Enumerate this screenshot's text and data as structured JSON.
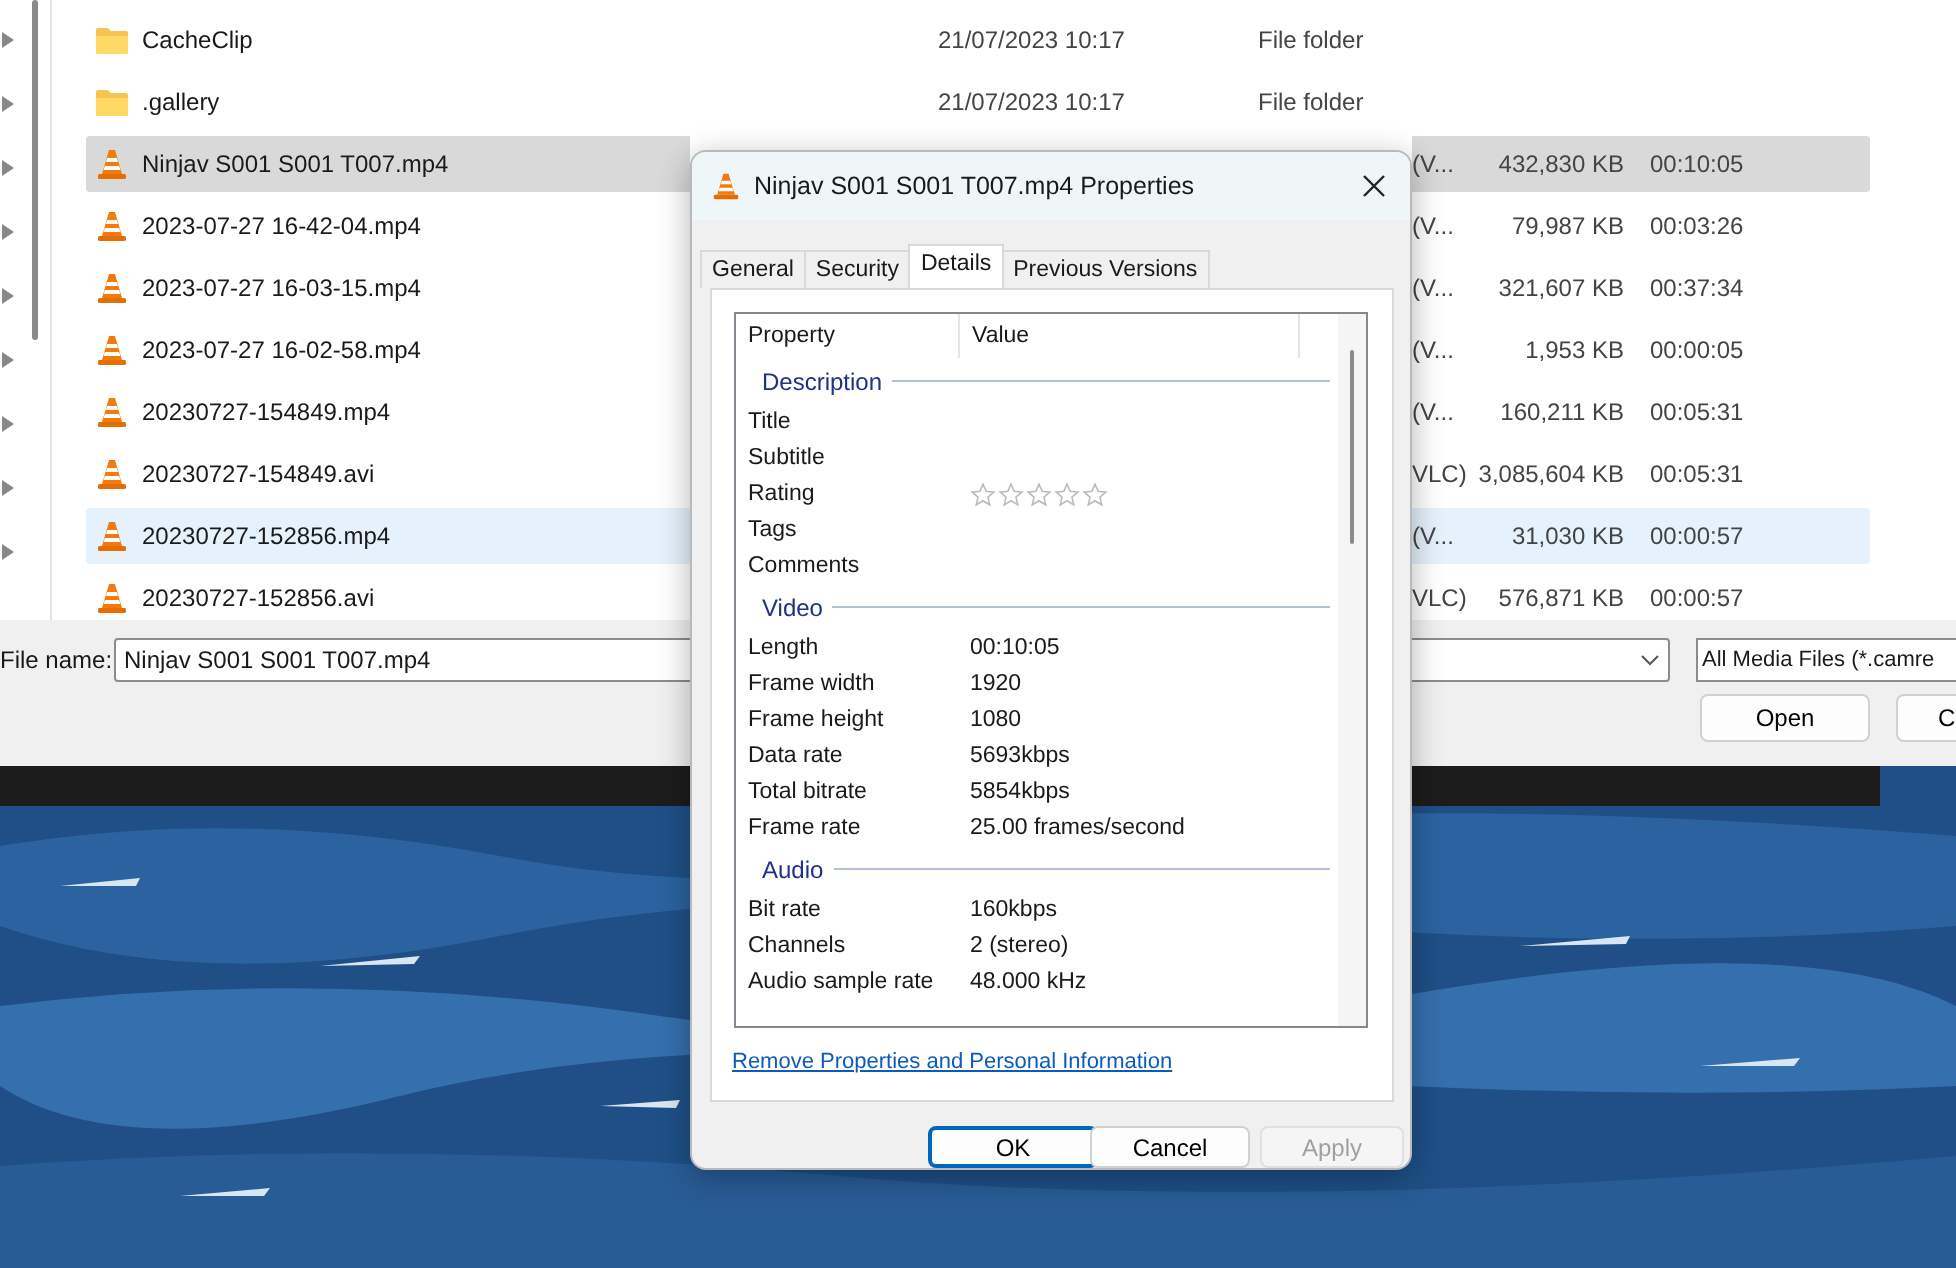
{
  "file_dialog": {
    "files": [
      {
        "kind": "folder",
        "name": "CacheClip",
        "date": "21/07/2023 10:17",
        "type": "File folder",
        "selected": false,
        "hovered": false
      },
      {
        "kind": "folder",
        "name": ".gallery",
        "date": "21/07/2023 10:17",
        "type": "File folder",
        "selected": false,
        "hovered": false
      },
      {
        "kind": "video",
        "name": "Ninjav S001 S001 T007.mp4",
        "type": "(V...",
        "size": "432,830 KB",
        "length": "00:10:05",
        "selected": true,
        "hovered": false
      },
      {
        "kind": "video",
        "name": "2023-07-27 16-42-04.mp4",
        "type": "(V...",
        "size": "79,987 KB",
        "length": "00:03:26",
        "selected": false,
        "hovered": false
      },
      {
        "kind": "video",
        "name": "2023-07-27 16-03-15.mp4",
        "type": "(V...",
        "size": "321,607 KB",
        "length": "00:37:34",
        "selected": false,
        "hovered": false
      },
      {
        "kind": "video",
        "name": "2023-07-27 16-02-58.mp4",
        "type": "(V...",
        "size": "1,953 KB",
        "length": "00:00:05",
        "selected": false,
        "hovered": false
      },
      {
        "kind": "video",
        "name": "20230727-154849.mp4",
        "type": "(V...",
        "size": "160,211 KB",
        "length": "00:05:31",
        "selected": false,
        "hovered": false
      },
      {
        "kind": "video",
        "name": "20230727-154849.avi",
        "type": "VLC)",
        "size": "3,085,604 KB",
        "length": "00:05:31",
        "selected": false,
        "hovered": false
      },
      {
        "kind": "video",
        "name": "20230727-152856.mp4",
        "type": "(V...",
        "size": "31,030 KB",
        "length": "00:00:57",
        "selected": false,
        "hovered": true
      },
      {
        "kind": "video",
        "name": "20230727-152856.avi",
        "type": "VLC)",
        "size": "576,871 KB",
        "length": "00:00:57",
        "selected": false,
        "hovered": false
      }
    ],
    "file_name": {
      "label": "File name:",
      "value": "Ninjav S001 S001 T007.mp4"
    },
    "filter": "All Media Files (*.camre",
    "buttons": [
      "Open",
      "C"
    ]
  },
  "properties": {
    "title": "Ninjav S001 S001 T007.mp4 Properties",
    "tabs": [
      {
        "label": "General",
        "selected": false
      },
      {
        "label": "Security",
        "selected": false
      },
      {
        "label": "Details",
        "selected": true
      },
      {
        "label": "Previous Versions",
        "selected": false
      }
    ],
    "columns": [
      "Property",
      "Value"
    ],
    "sections": [
      {
        "heading": "Description",
        "rows": [
          {
            "kind": "text",
            "property": "Title"
          },
          {
            "kind": "text",
            "property": "Subtitle"
          },
          {
            "kind": "rating",
            "property": "Rating",
            "stars": 0
          },
          {
            "kind": "text",
            "property": "Tags"
          },
          {
            "kind": "text",
            "property": "Comments"
          }
        ]
      },
      {
        "heading": "Video",
        "rows": [
          {
            "kind": "text",
            "property": "Length",
            "value": "00:10:05"
          },
          {
            "kind": "text",
            "property": "Frame width",
            "value": "1920"
          },
          {
            "kind": "text",
            "property": "Frame height",
            "value": "1080"
          },
          {
            "kind": "text",
            "property": "Data rate",
            "value": "5693kbps"
          },
          {
            "kind": "text",
            "property": "Total bitrate",
            "value": "5854kbps"
          },
          {
            "kind": "text",
            "property": "Frame rate",
            "value": "25.00 frames/second"
          }
        ]
      },
      {
        "heading": "Audio",
        "rows": [
          {
            "kind": "text",
            "property": "Bit rate",
            "value": "160kbps"
          },
          {
            "kind": "text",
            "property": "Channels",
            "value": "2 (stereo)"
          },
          {
            "kind": "text",
            "property": "Audio sample rate",
            "value": "48.000 kHz"
          }
        ]
      }
    ],
    "link": "Remove Properties and Personal Information",
    "buttons": [
      {
        "label": "OK",
        "kind": "default",
        "disabled": false
      },
      {
        "label": "Cancel",
        "kind": "normal",
        "disabled": false
      },
      {
        "label": "Apply",
        "kind": "normal",
        "disabled": true
      }
    ]
  }
}
